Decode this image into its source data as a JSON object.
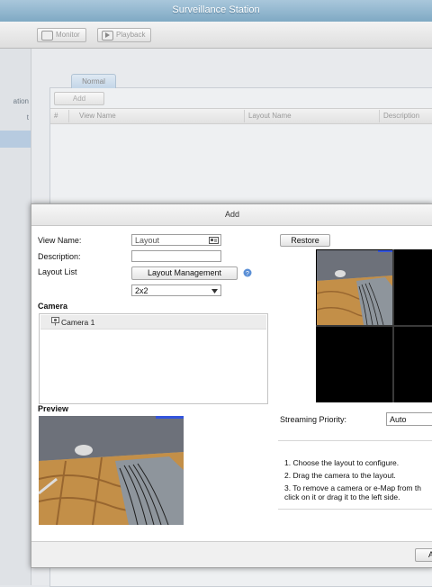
{
  "app": {
    "title": "Surveillance Station"
  },
  "toolbar": {
    "monitor_label": "Monitor",
    "playback_label": "Playback"
  },
  "sidebar": {
    "items": [
      {
        "label": "ation"
      },
      {
        "label": "t"
      }
    ]
  },
  "main": {
    "tab_label": "Normal",
    "add_label": "Add",
    "columns": [
      "#",
      "View Name",
      "Layout Name",
      "Description"
    ]
  },
  "dialog": {
    "title": "Add",
    "view_name_label": "View Name:",
    "view_name_value": "Layout",
    "description_label": "Description:",
    "description_value": "",
    "layout_list_label": "Layout List",
    "layout_management_label": "Layout Management",
    "layout_select_value": "2x2",
    "camera_section_label": "Camera",
    "camera_items": [
      "Camera 1"
    ],
    "preview_label": "Preview",
    "restore_label": "Restore",
    "streaming_priority_label": "Streaming Priority:",
    "streaming_priority_value": "Auto",
    "instructions": [
      "1. Choose the layout to configure.",
      "2. Drag the camera to the layout.",
      "3. To remove a camera or e-Map from th",
      "click on it or drag it to the left side."
    ],
    "footer_button_label": "A"
  },
  "colors": {
    "title_bar": "#8fb5cf",
    "selection": "#b7cbe0",
    "help_icon": "#5b8fd6"
  },
  "icons": [
    "camera-icon",
    "contact-card-icon",
    "help-icon",
    "chevron-down-icon",
    "monitor-icon",
    "playback-icon"
  ]
}
